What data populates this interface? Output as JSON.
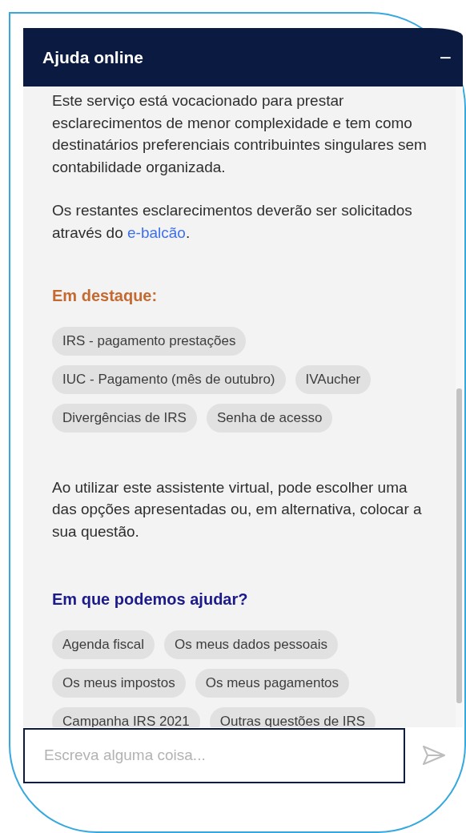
{
  "header": {
    "title": "Ajuda online",
    "minimize_symbol": "−"
  },
  "intro": "Este serviço está vocacionado para prestar esclarecimentos de menor complexidade e tem como destinatários preferenciais contribuintes singulares sem contabilidade organizada.",
  "referral": {
    "before": "Os restantes esclarecimentos deverão ser solicitados através do ",
    "link": "e-balcão",
    "after": "."
  },
  "sections": [
    {
      "title": "Em destaque:",
      "color": "#c4692f",
      "chips": [
        "IRS - pagamento prestações",
        "IUC - Pagamento (mês de outubro)",
        "IVAucher",
        "Divergências de IRS",
        "Senha de acesso"
      ]
    },
    {
      "note": "Ao utilizar este assistente virtual, pode escolher uma das opções apresentadas ou, em alternativa, colocar a sua questão.",
      "title": "Em que podemos ajudar?",
      "color": "#1c1a8a",
      "chips": [
        "Agenda fiscal",
        "Os meus dados pessoais",
        "Os meus impostos",
        "Os meus pagamentos",
        "Campanha IRS 2021",
        "Outras questões de IRS"
      ]
    }
  ],
  "input": {
    "placeholder": "Escreva alguma coisa..."
  }
}
